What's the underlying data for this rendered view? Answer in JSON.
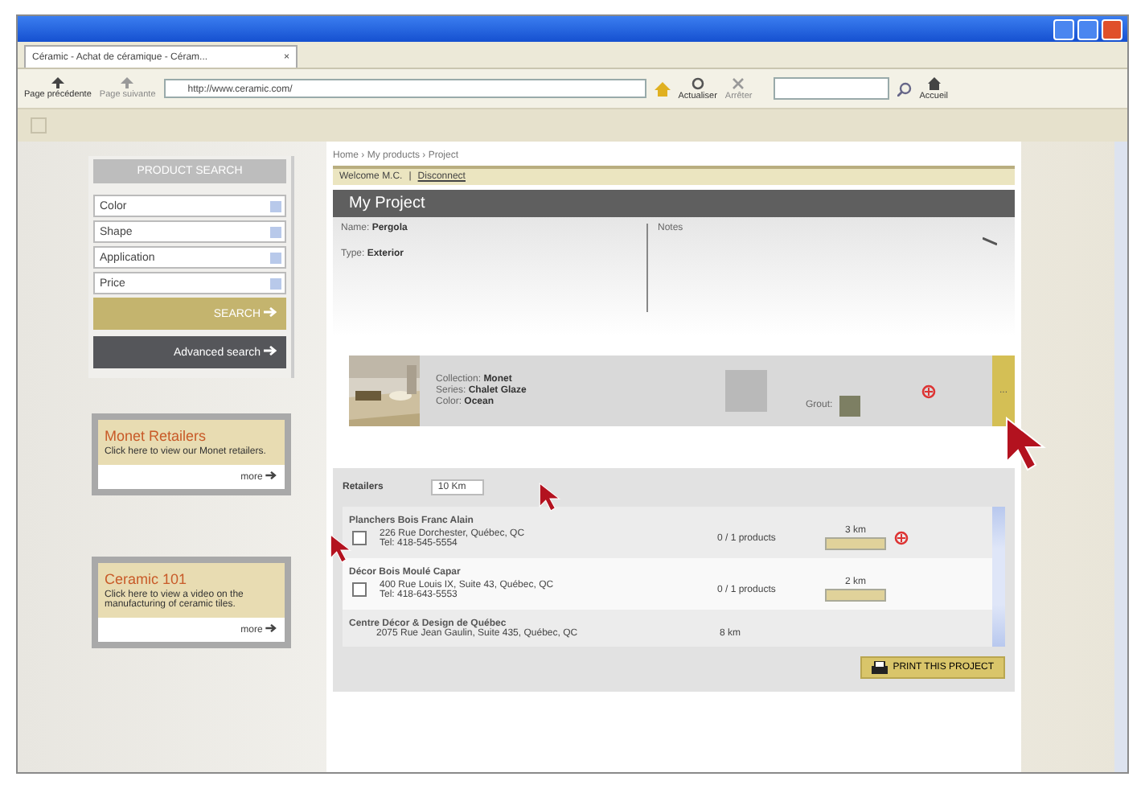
{
  "tab": {
    "title": "Céramic - Achat de céramique - Céram...",
    "close": "×"
  },
  "toolbar": {
    "back": "Page précédente",
    "forward": "Page suivante",
    "address": "http://www.ceramic.com/",
    "refresh": "Actualiser",
    "stop": "Arrêter",
    "home": "Accueil"
  },
  "sidebar": {
    "title": "PRODUCT SEARCH",
    "filters": [
      {
        "placeholder": "Color"
      },
      {
        "placeholder": "Shape"
      },
      {
        "placeholder": "Application"
      },
      {
        "placeholder": "Price"
      }
    ],
    "search": "SEARCH",
    "advanced": "Advanced search",
    "promos": [
      {
        "title": "Monet Retailers",
        "text": "Click here to view our Monet retailers.",
        "more": "more"
      },
      {
        "title": "Ceramic 101",
        "text": "Click here to view a video on the manufacturing of ceramic tiles.",
        "more": "more"
      }
    ]
  },
  "main": {
    "breadcrumb": "Home › My products › Project",
    "welcome": "Welcome M.C.",
    "separator": "|",
    "disconnect": "Disconnect",
    "project": {
      "title": "My Project",
      "name_label": "Name:",
      "name": "Pergola",
      "type_label": "Type:",
      "type": "Exterior",
      "notes_label": "Notes"
    },
    "product": {
      "collection_label": "Collection:",
      "collection": "Monet",
      "series_label": "Series:",
      "series": "Chalet Glaze",
      "color_label": "Color:",
      "color_name": "Ocean",
      "grout_label": "Grout:",
      "side_tab": "..."
    },
    "retailers": {
      "label": "Retailers",
      "distance": "10 Km",
      "rows": [
        {
          "name": "Planchers Bois Franc Alain",
          "address": "226 Rue Dorchester, Québec, QC",
          "phone": "Tel: 418-545-5554",
          "products": "0 / 1 products",
          "km": "3 km",
          "checked": false,
          "removable": true
        },
        {
          "name": "Décor Bois Moulé Capar",
          "address": "400 Rue Louis IX, Suite 43, Québec, QC",
          "phone": "Tel: 418-643-5553",
          "products": "0 / 1 products",
          "km": "2 km",
          "checked": false,
          "removable": false
        },
        {
          "name": "Centre Décor & Design de Québec",
          "address": "2075 Rue Jean Gaulin, Suite 435, Québec, QC",
          "km": "8 km",
          "removable": false
        }
      ],
      "print": "PRINT THIS PROJECT"
    }
  }
}
